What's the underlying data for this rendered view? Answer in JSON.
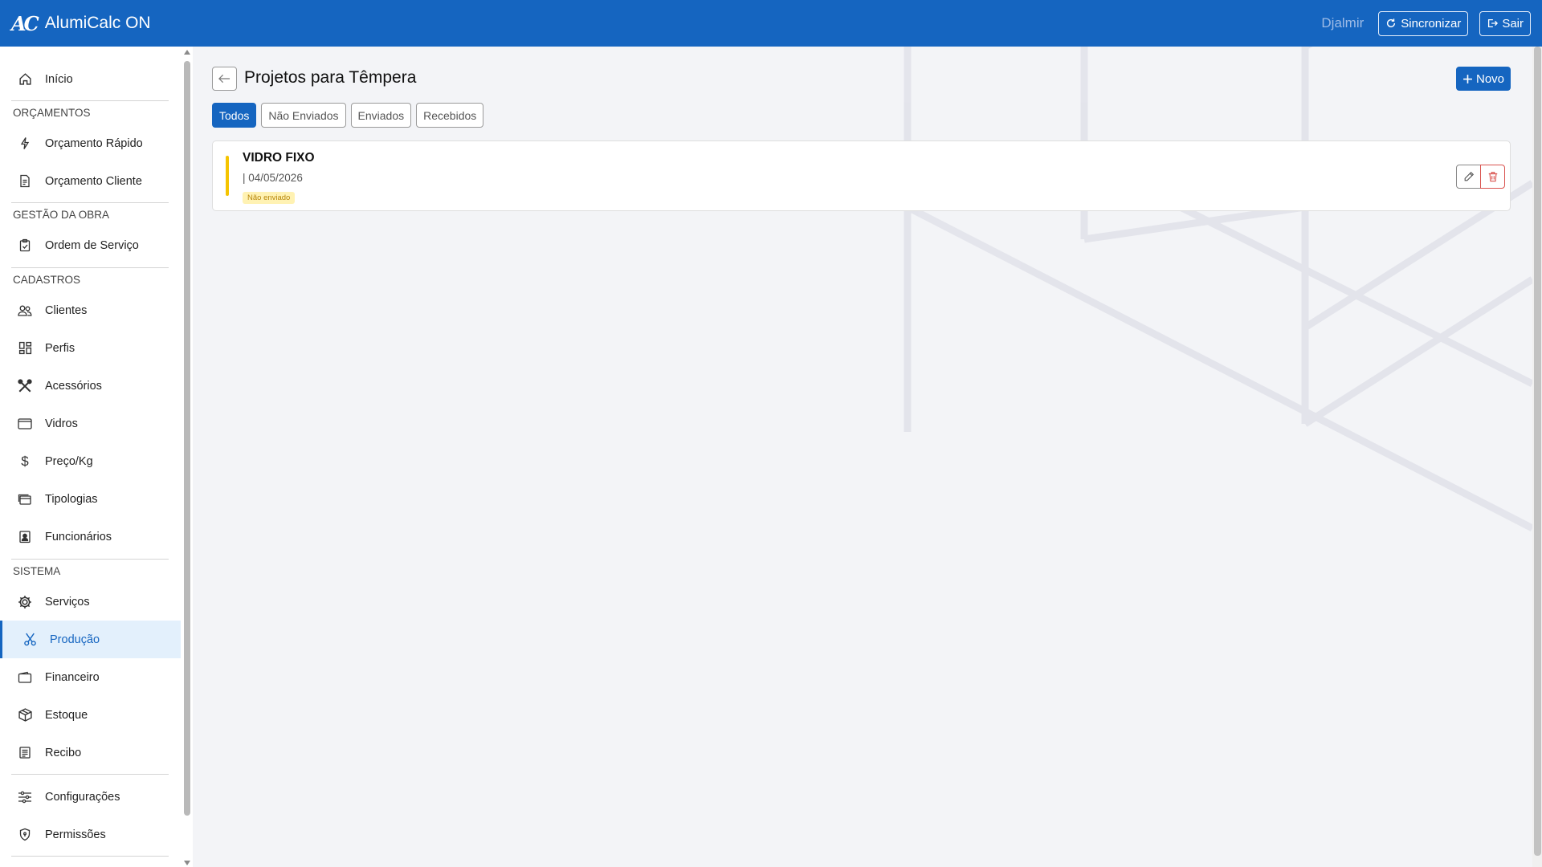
{
  "app": {
    "title": "AlumiCalc ON",
    "logo_text": "AC"
  },
  "header": {
    "user": "Djalmir",
    "sync_label": "Sincronizar",
    "logout_label": "Sair"
  },
  "sidebar": {
    "items": [
      {
        "label": "Início",
        "icon": "home-icon"
      },
      {
        "section": "ORÇAMENTOS"
      },
      {
        "label": "Orçamento Rápido",
        "icon": "bolt-icon"
      },
      {
        "label": "Orçamento Cliente",
        "icon": "document-icon"
      },
      {
        "section": "GESTÃO DA OBRA"
      },
      {
        "label": "Ordem de Serviço",
        "icon": "clipboard-check-icon"
      },
      {
        "section": "CADASTROS"
      },
      {
        "label": "Clientes",
        "icon": "people-icon"
      },
      {
        "label": "Perfis",
        "icon": "grid-icon"
      },
      {
        "label": "Acessórios",
        "icon": "tools-icon"
      },
      {
        "label": "Vidros",
        "icon": "window-icon"
      },
      {
        "label": "Preço/Kg",
        "icon": "dollar-icon"
      },
      {
        "label": "Tipologias",
        "icon": "layers-icon"
      },
      {
        "label": "Funcionários",
        "icon": "badge-icon"
      },
      {
        "section": "SISTEMA"
      },
      {
        "label": "Serviços",
        "icon": "gear-icon"
      },
      {
        "label": "Produção",
        "icon": "scissors-icon",
        "active": true
      },
      {
        "label": "Financeiro",
        "icon": "wallet-icon"
      },
      {
        "label": "Estoque",
        "icon": "box-icon"
      },
      {
        "label": "Recibo",
        "icon": "receipt-icon"
      },
      {
        "label": "Configurações",
        "icon": "sliders-icon"
      },
      {
        "label": "Permissões",
        "icon": "shield-icon"
      }
    ]
  },
  "main": {
    "title": "Projetos para Têmpera",
    "new_label": "Novo",
    "filters": [
      {
        "label": "Todos",
        "active": true
      },
      {
        "label": "Não Enviados"
      },
      {
        "label": "Enviados"
      },
      {
        "label": "Recebidos"
      }
    ],
    "projects": [
      {
        "title": "VIDRO FIXO",
        "date": "| 04/05/2026",
        "status": "Não enviado",
        "status_color": "#f5c400"
      }
    ]
  },
  "colors": {
    "primary": "#1565c0",
    "active_bg": "#e3f0fc",
    "warning": "#f5c400",
    "danger": "#d9534f"
  }
}
